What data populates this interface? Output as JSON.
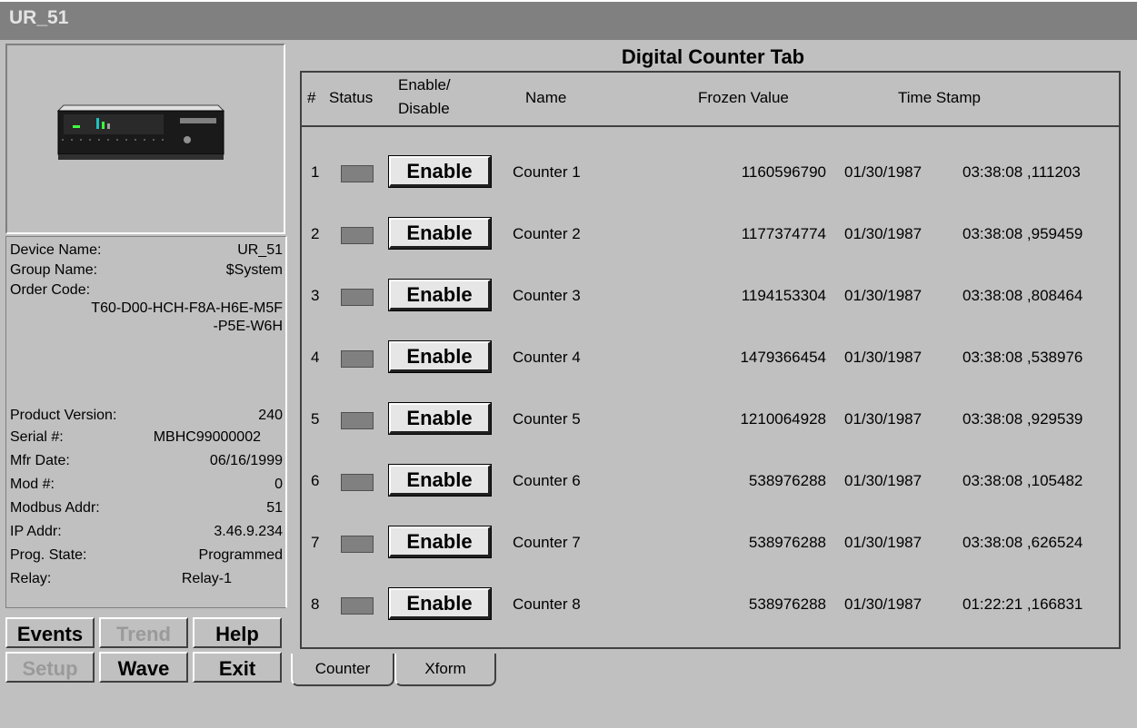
{
  "window": {
    "title": "UR_51"
  },
  "device": {
    "fields": [
      {
        "label": "Device Name:",
        "value": "UR_51"
      },
      {
        "label": "Group Name:",
        "value": "$System"
      },
      {
        "label": "Order Code:",
        "value": ""
      },
      {
        "label": "",
        "value": "T60-D00-HCH-F8A-H6E-M5F"
      },
      {
        "label": "",
        "value": "-P5E-W6H"
      },
      {
        "label": "Product Version:",
        "value": "240"
      },
      {
        "label": "Serial #:",
        "value": "MBHC99000002"
      },
      {
        "label": "Mfr Date:",
        "value": "06/16/1999"
      },
      {
        "label": "Mod #:",
        "value": "0"
      },
      {
        "label": "Modbus Addr:",
        "value": "51"
      },
      {
        "label": "IP Addr:",
        "value": "3.46.9.234"
      },
      {
        "label": "Prog. State:",
        "value": "Programmed"
      },
      {
        "label": "Relay:",
        "value": "Relay-1"
      }
    ]
  },
  "buttons": {
    "events": "Events",
    "trend": "Trend",
    "help": "Help",
    "setup": "Setup",
    "wave": "Wave",
    "exit": "Exit"
  },
  "main": {
    "title": "Digital Counter Tab",
    "headers": {
      "num": "#",
      "status": "Status",
      "enable1": "Enable/",
      "enable2": "Disable",
      "name": "Name",
      "frozen": "Frozen Value",
      "timestamp": "Time Stamp"
    },
    "rows": [
      {
        "num": "1",
        "button": "Enable",
        "name": "Counter 1",
        "frozen": "1160596790",
        "date": "01/30/1987",
        "time": "03:38:08 ,111203"
      },
      {
        "num": "2",
        "button": "Enable",
        "name": "Counter 2",
        "frozen": "1177374774",
        "date": "01/30/1987",
        "time": "03:38:08 ,959459"
      },
      {
        "num": "3",
        "button": "Enable",
        "name": "Counter 3",
        "frozen": "1194153304",
        "date": "01/30/1987",
        "time": "03:38:08 ,808464"
      },
      {
        "num": "4",
        "button": "Enable",
        "name": "Counter 4",
        "frozen": "1479366454",
        "date": "01/30/1987",
        "time": "03:38:08 ,538976"
      },
      {
        "num": "5",
        "button": "Enable",
        "name": "Counter 5",
        "frozen": "1210064928",
        "date": "01/30/1987",
        "time": "03:38:08 ,929539"
      },
      {
        "num": "6",
        "button": "Enable",
        "name": "Counter 6",
        "frozen": "538976288",
        "date": "01/30/1987",
        "time": "03:38:08 ,105482"
      },
      {
        "num": "7",
        "button": "Enable",
        "name": "Counter 7",
        "frozen": "538976288",
        "date": "01/30/1987",
        "time": "03:38:08 ,626524"
      },
      {
        "num": "8",
        "button": "Enable",
        "name": "Counter 8",
        "frozen": "538976288",
        "date": "01/30/1987",
        "time": "01:22:21 ,166831"
      }
    ],
    "tabs": [
      {
        "label": "Counter"
      },
      {
        "label": "Xform"
      }
    ]
  }
}
